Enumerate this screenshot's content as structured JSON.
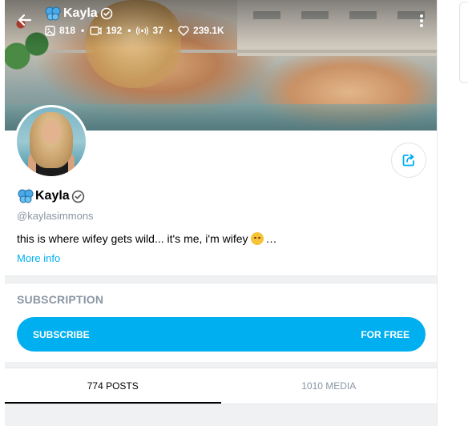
{
  "profile": {
    "display_name": "Kayla",
    "handle": "@kaylasimmons",
    "bio": "this is where wifey gets wild... it's me, i'm wifey",
    "bio_ellipsis": "…",
    "more_info_label": "More info",
    "verified_icon": "verified-badge-icon",
    "name_prefix_icon": "butterfly-icon"
  },
  "stats": {
    "photos": "818",
    "videos": "192",
    "streams": "37",
    "likes": "239.1K"
  },
  "subscription": {
    "section_title": "SUBSCRIPTION",
    "button_label": "SUBSCRIBE",
    "price_label": "FOR FREE"
  },
  "tabs": [
    {
      "label": "774 POSTS",
      "active": true
    },
    {
      "label": "1010 MEDIA",
      "active": false
    }
  ],
  "colors": {
    "accent": "#00aff0",
    "muted_text": "#8a96a3",
    "butterfly": "#2f8fd0"
  }
}
